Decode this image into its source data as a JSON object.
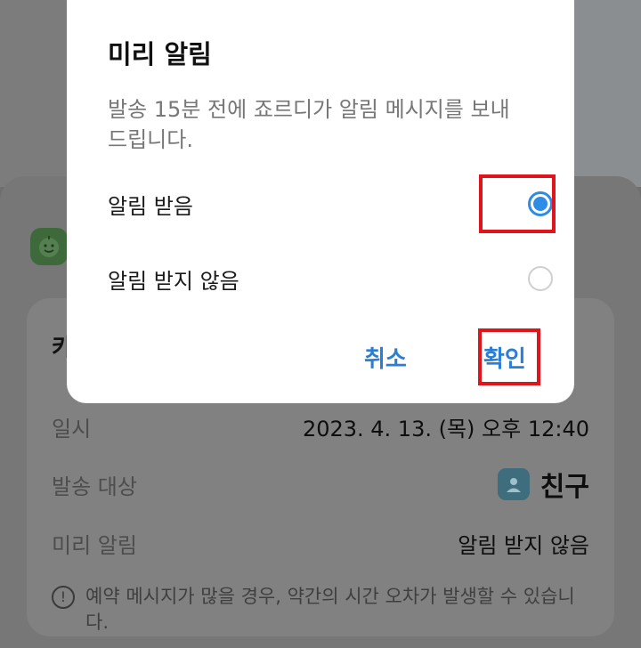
{
  "background": {
    "card_title": "카",
    "rows": [
      {
        "label": "일시",
        "value": "2023. 4. 13. (목) 오후 12:40"
      },
      {
        "label": "발송 대상",
        "value": "친구"
      },
      {
        "label": "미리 알림",
        "value": "알림 받지 않음"
      }
    ],
    "notice": "예약 메시지가 많을 경우, 약간의 시간 오차가 발생할 수 있습니다."
  },
  "dialog": {
    "title": "미리 알림",
    "description": "발송 15분 전에 죠르디가 알림 메시지를 보내드립니다.",
    "options": [
      {
        "label": "알림 받음",
        "selected": true
      },
      {
        "label": "알림 받지 않음",
        "selected": false
      }
    ],
    "cancel_label": "취소",
    "confirm_label": "확인"
  },
  "colors": {
    "accent": "#2e8be8",
    "highlight": "#e0151c"
  }
}
